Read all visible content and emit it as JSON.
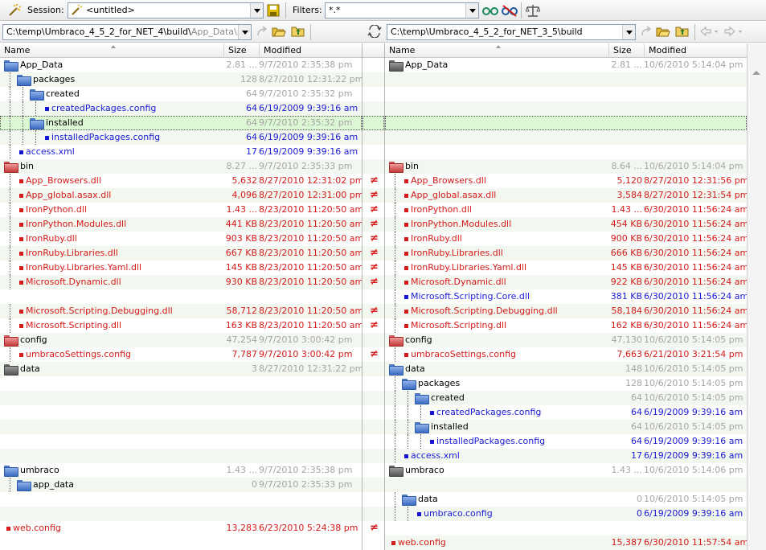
{
  "toolbar": {
    "session_label": "Session:",
    "session_value": "<untitled>",
    "filters_label": "Filters:",
    "filters_value": "*.*"
  },
  "paths": {
    "left_main": "C:\\temp\\Umbraco_4_5_2_for_NET_4\\build\\",
    "left_dim": "App_Data\\pac",
    "right": "C:\\temp\\Umbraco_4_5_2_for_NET_3_5\\build"
  },
  "columns": {
    "name": "Name",
    "size": "Size",
    "modified": "Modified"
  },
  "left_rows": [
    {
      "name": "App_Data",
      "size": "2.81 ...",
      "mod": "9/7/2010 2:35:38 pm",
      "kind": "folder",
      "color": "blue",
      "tc": "black",
      "sc": "gray",
      "indent": 0
    },
    {
      "name": "packages",
      "size": "128",
      "mod": "8/27/2010 12:31:22 pm",
      "kind": "folder",
      "color": "blue",
      "tc": "black",
      "sc": "gray",
      "indent": 1
    },
    {
      "name": "created",
      "size": "64",
      "mod": "9/7/2010 2:35:32 pm",
      "kind": "folder",
      "color": "blue",
      "tc": "black",
      "sc": "gray",
      "indent": 2
    },
    {
      "name": "createdPackages.config",
      "size": "64",
      "mod": "6/19/2009 9:39:16 am",
      "kind": "file",
      "color": "blue",
      "tc": "blue",
      "sc": "blue",
      "indent": 3
    },
    {
      "name": "installed",
      "size": "64",
      "mod": "9/7/2010 2:35:32 pm",
      "kind": "folder",
      "color": "blue",
      "tc": "black",
      "sc": "gray",
      "indent": 2,
      "sel": true
    },
    {
      "name": "installedPackages.config",
      "size": "64",
      "mod": "6/19/2009 9:39:16 am",
      "kind": "file",
      "color": "blue",
      "tc": "blue",
      "sc": "blue",
      "indent": 3
    },
    {
      "name": "access.xml",
      "size": "17",
      "mod": "6/19/2009 9:39:16 am",
      "kind": "file",
      "color": "blue",
      "tc": "blue",
      "sc": "blue",
      "indent": 1
    },
    {
      "name": "bin",
      "size": "8.27 ...",
      "mod": "9/7/2010 2:35:33 pm",
      "kind": "folder",
      "color": "red",
      "tc": "black",
      "sc": "gray",
      "indent": 0
    },
    {
      "name": "App_Browsers.dll",
      "size": "5,632",
      "mod": "8/27/2010 12:31:02 pm",
      "kind": "file",
      "color": "red",
      "tc": "red",
      "sc": "red",
      "indent": 1,
      "diff": true
    },
    {
      "name": "App_global.asax.dll",
      "size": "4,096",
      "mod": "8/27/2010 12:31:00 pm",
      "kind": "file",
      "color": "red",
      "tc": "red",
      "sc": "red",
      "indent": 1,
      "diff": true
    },
    {
      "name": "IronPython.dll",
      "size": "1.43 ...",
      "mod": "8/23/2010 11:20:50 am",
      "kind": "file",
      "color": "red",
      "tc": "red",
      "sc": "red",
      "indent": 1,
      "diff": true
    },
    {
      "name": "IronPython.Modules.dll",
      "size": "441 KB",
      "mod": "8/23/2010 11:20:50 am",
      "kind": "file",
      "color": "red",
      "tc": "red",
      "sc": "red",
      "indent": 1,
      "diff": true
    },
    {
      "name": "IronRuby.dll",
      "size": "903 KB",
      "mod": "8/23/2010 11:20:50 am",
      "kind": "file",
      "color": "red",
      "tc": "red",
      "sc": "red",
      "indent": 1,
      "diff": true
    },
    {
      "name": "IronRuby.Libraries.dll",
      "size": "667 KB",
      "mod": "8/23/2010 11:20:50 am",
      "kind": "file",
      "color": "red",
      "tc": "red",
      "sc": "red",
      "indent": 1,
      "diff": true
    },
    {
      "name": "IronRuby.Libraries.Yaml.dll",
      "size": "145 KB",
      "mod": "8/23/2010 11:20:50 am",
      "kind": "file",
      "color": "red",
      "tc": "red",
      "sc": "red",
      "indent": 1,
      "diff": true
    },
    {
      "name": "Microsoft.Dynamic.dll",
      "size": "930 KB",
      "mod": "8/23/2010 11:20:50 am",
      "kind": "file",
      "color": "red",
      "tc": "red",
      "sc": "red",
      "indent": 1,
      "diff": true
    },
    {
      "kind": "empty",
      "indent": 1
    },
    {
      "name": "Microsoft.Scripting.Debugging.dll",
      "size": "58,712",
      "mod": "8/23/2010 11:20:50 am",
      "kind": "file",
      "color": "red",
      "tc": "red",
      "sc": "red",
      "indent": 1,
      "diff": true
    },
    {
      "name": "Microsoft.Scripting.dll",
      "size": "163 KB",
      "mod": "8/23/2010 11:20:50 am",
      "kind": "file",
      "color": "red",
      "tc": "red",
      "sc": "red",
      "indent": 1,
      "diff": true
    },
    {
      "name": "config",
      "size": "47,254",
      "mod": "9/7/2010 3:00:42 pm",
      "kind": "folder",
      "color": "red",
      "tc": "black",
      "sc": "gray",
      "indent": 0
    },
    {
      "name": "umbracoSettings.config",
      "size": "7,787",
      "mod": "9/7/2010 3:00:42 pm",
      "kind": "file",
      "color": "red",
      "tc": "red",
      "sc": "red",
      "indent": 1,
      "diff": true
    },
    {
      "name": "data",
      "size": "3",
      "mod": "8/27/2010 12:31:22 pm",
      "kind": "folder",
      "color": "gray",
      "tc": "black",
      "sc": "gray",
      "indent": 0
    },
    {
      "kind": "empty"
    },
    {
      "kind": "empty"
    },
    {
      "kind": "empty"
    },
    {
      "kind": "empty"
    },
    {
      "kind": "empty"
    },
    {
      "kind": "empty"
    },
    {
      "name": "umbraco",
      "size": "1.43 ...",
      "mod": "9/7/2010 2:35:38 pm",
      "kind": "folder",
      "color": "blue",
      "tc": "black",
      "sc": "gray",
      "indent": 0
    },
    {
      "name": "app_data",
      "size": "0",
      "mod": "9/7/2010 2:35:33 pm",
      "kind": "folder",
      "color": "blue",
      "tc": "black",
      "sc": "gray",
      "indent": 1
    },
    {
      "kind": "empty"
    },
    {
      "kind": "empty"
    },
    {
      "name": "web.config",
      "size": "13,283",
      "mod": "6/23/2010 5:24:38 pm",
      "kind": "file",
      "color": "red",
      "tc": "red",
      "sc": "red",
      "indent": 0,
      "diff": true
    }
  ],
  "right_rows": [
    {
      "name": "App_Data",
      "size": "2.81 ...",
      "mod": "10/6/2010 5:14:04 pm",
      "kind": "folder",
      "color": "gray",
      "tc": "black",
      "sc": "gray",
      "indent": 0
    },
    {
      "kind": "empty"
    },
    {
      "kind": "empty"
    },
    {
      "kind": "empty"
    },
    {
      "kind": "empty",
      "sel": true
    },
    {
      "kind": "empty"
    },
    {
      "kind": "empty"
    },
    {
      "name": "bin",
      "size": "8.64 ...",
      "mod": "10/6/2010 5:14:04 pm",
      "kind": "folder",
      "color": "red",
      "tc": "black",
      "sc": "gray",
      "indent": 0
    },
    {
      "name": "App_Browsers.dll",
      "size": "5,120",
      "mod": "8/27/2010 12:31:56 pm",
      "kind": "file",
      "color": "red",
      "tc": "red",
      "sc": "red",
      "indent": 1
    },
    {
      "name": "App_global.asax.dll",
      "size": "3,584",
      "mod": "8/27/2010 12:31:54 pm",
      "kind": "file",
      "color": "red",
      "tc": "red",
      "sc": "red",
      "indent": 1
    },
    {
      "name": "IronPython.dll",
      "size": "1.43 ...",
      "mod": "6/30/2010 11:56:24 am",
      "kind": "file",
      "color": "red",
      "tc": "red",
      "sc": "red",
      "indent": 1
    },
    {
      "name": "IronPython.Modules.dll",
      "size": "454 KB",
      "mod": "6/30/2010 11:56:24 am",
      "kind": "file",
      "color": "red",
      "tc": "red",
      "sc": "red",
      "indent": 1
    },
    {
      "name": "IronRuby.dll",
      "size": "900 KB",
      "mod": "6/30/2010 11:56:24 am",
      "kind": "file",
      "color": "red",
      "tc": "red",
      "sc": "red",
      "indent": 1
    },
    {
      "name": "IronRuby.Libraries.dll",
      "size": "666 KB",
      "mod": "6/30/2010 11:56:24 am",
      "kind": "file",
      "color": "red",
      "tc": "red",
      "sc": "red",
      "indent": 1
    },
    {
      "name": "IronRuby.Libraries.Yaml.dll",
      "size": "145 KB",
      "mod": "6/30/2010 11:56:24 am",
      "kind": "file",
      "color": "red",
      "tc": "red",
      "sc": "red",
      "indent": 1
    },
    {
      "name": "Microsoft.Dynamic.dll",
      "size": "922 KB",
      "mod": "6/30/2010 11:56:24 am",
      "kind": "file",
      "color": "red",
      "tc": "red",
      "sc": "red",
      "indent": 1
    },
    {
      "name": "Microsoft.Scripting.Core.dll",
      "size": "381 KB",
      "mod": "6/30/2010 11:56:24 am",
      "kind": "file",
      "color": "blue",
      "tc": "blue",
      "sc": "blue",
      "indent": 1
    },
    {
      "name": "Microsoft.Scripting.Debugging.dll",
      "size": "58,184",
      "mod": "6/30/2010 11:56:24 am",
      "kind": "file",
      "color": "red",
      "tc": "red",
      "sc": "red",
      "indent": 1
    },
    {
      "name": "Microsoft.Scripting.dll",
      "size": "162 KB",
      "mod": "6/30/2010 11:56:24 am",
      "kind": "file",
      "color": "red",
      "tc": "red",
      "sc": "red",
      "indent": 1
    },
    {
      "name": "config",
      "size": "47,130",
      "mod": "10/6/2010 5:14:05 pm",
      "kind": "folder",
      "color": "red",
      "tc": "black",
      "sc": "gray",
      "indent": 0
    },
    {
      "name": "umbracoSettings.config",
      "size": "7,663",
      "mod": "6/21/2010 3:21:54 pm",
      "kind": "file",
      "color": "red",
      "tc": "red",
      "sc": "red",
      "indent": 1
    },
    {
      "name": "data",
      "size": "148",
      "mod": "10/6/2010 5:14:05 pm",
      "kind": "folder",
      "color": "blue",
      "tc": "black",
      "sc": "gray",
      "indent": 0
    },
    {
      "name": "packages",
      "size": "128",
      "mod": "10/6/2010 5:14:05 pm",
      "kind": "folder",
      "color": "blue",
      "tc": "black",
      "sc": "gray",
      "indent": 1
    },
    {
      "name": "created",
      "size": "64",
      "mod": "10/6/2010 5:14:05 pm",
      "kind": "folder",
      "color": "blue",
      "tc": "black",
      "sc": "gray",
      "indent": 2
    },
    {
      "name": "createdPackages.config",
      "size": "64",
      "mod": "6/19/2009 9:39:16 am",
      "kind": "file",
      "color": "blue",
      "tc": "blue",
      "sc": "blue",
      "indent": 3
    },
    {
      "name": "installed",
      "size": "64",
      "mod": "10/6/2010 5:14:05 pm",
      "kind": "folder",
      "color": "blue",
      "tc": "black",
      "sc": "gray",
      "indent": 2
    },
    {
      "name": "installedPackages.config",
      "size": "64",
      "mod": "6/19/2009 9:39:16 am",
      "kind": "file",
      "color": "blue",
      "tc": "blue",
      "sc": "blue",
      "indent": 3
    },
    {
      "name": "access.xml",
      "size": "17",
      "mod": "6/19/2009 9:39:16 am",
      "kind": "file",
      "color": "blue",
      "tc": "blue",
      "sc": "blue",
      "indent": 1
    },
    {
      "name": "umbraco",
      "size": "1.43 ...",
      "mod": "10/6/2010 5:14:06 pm",
      "kind": "folder",
      "color": "gray",
      "tc": "black",
      "sc": "gray",
      "indent": 0
    },
    {
      "kind": "empty"
    },
    {
      "name": "data",
      "size": "0",
      "mod": "10/6/2010 5:14:05 pm",
      "kind": "folder",
      "color": "blue",
      "tc": "black",
      "sc": "gray",
      "indent": 1
    },
    {
      "name": "umbraco.config",
      "size": "0",
      "mod": "6/19/2009 9:39:16 am",
      "kind": "file",
      "color": "blue",
      "tc": "blue",
      "sc": "blue",
      "indent": 2
    },
    {
      "kind": "empty"
    },
    {
      "name": "web.config",
      "size": "15,387",
      "mod": "6/30/2010 11:57:54 am",
      "kind": "file",
      "color": "red",
      "tc": "red",
      "sc": "red",
      "indent": 0
    }
  ],
  "diff_symbol": "≠"
}
